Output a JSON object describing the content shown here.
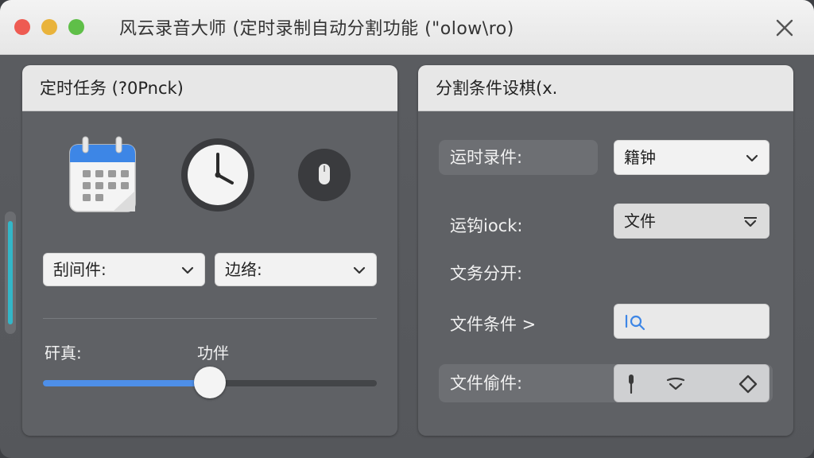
{
  "window": {
    "title": "风云录音大师 (定时录制自动分割功能 (\"olow\\ro)"
  },
  "left_panel": {
    "title": "定时任务 (?0Pnck)",
    "icons": [
      "calendar-icon",
      "clock-icon",
      "mouse-icon"
    ],
    "dropdown_1": {
      "label": "刮间件:"
    },
    "dropdown_2": {
      "label": "边络:"
    },
    "slider_label_left": "矸真:",
    "slider_label_right": "功伴",
    "slider_value": 0.5
  },
  "right_panel": {
    "title": "分割条件设棋(x.",
    "rows": [
      {
        "label": "运时录件:",
        "value": "籍钟"
      },
      {
        "label": "运钩iock:",
        "value": "文件"
      },
      {
        "label": "文务分开:"
      },
      {
        "label": "文件条件 >"
      },
      {
        "label": "文件偷件:"
      }
    ]
  },
  "colors": {
    "accent_blue": "#4e8fe8",
    "scroll_teal": "#33b6c8"
  }
}
